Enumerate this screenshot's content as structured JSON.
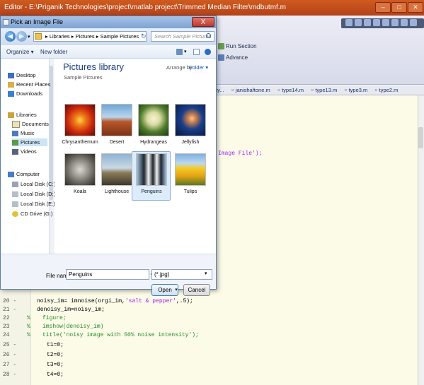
{
  "editor": {
    "title": "Editor - E:\\Priganik Technologies\\project\\matlab project\\Trimmed Median Filter\\mdbutmf.m",
    "toolbar": {
      "run_section": "Run Section",
      "advance": "Advance"
    },
    "tabs": [
      "ty...",
      "janishaftone.m",
      "type14.m",
      "type13.m",
      "type3.m",
      "type2.m"
    ],
    "visible_fragment": "Image File');",
    "lines": [
      {
        "num": "20 -",
        "code": "noisy_im= imnoise(orgi_im,",
        "str": "'salt & pepper'",
        "rest": ",.5);"
      },
      {
        "num": "21 -",
        "code": "denoisy_im=noisy_im;",
        "str": "",
        "rest": ""
      },
      {
        "num": "22",
        "pct": "%",
        "comment": "figure;"
      },
      {
        "num": "23",
        "pct": "%",
        "comment": "imshow(denoisy_im)"
      },
      {
        "num": "24",
        "pct": "%",
        "comment": "title('noisy image with 50% noise intensity');"
      },
      {
        "num": "25 -",
        "code": "t1=0;",
        "str": "",
        "rest": ""
      },
      {
        "num": "26 -",
        "code": "t2=0;",
        "str": "",
        "rest": ""
      },
      {
        "num": "27 -",
        "code": "t3=0;",
        "str": "",
        "rest": ""
      },
      {
        "num": "28 -",
        "code": "t4=0;",
        "str": "",
        "rest": ""
      }
    ]
  },
  "dialog": {
    "title": "Pick an Image File",
    "close_label": "X",
    "address": "▸ Libraries ▸ Pictures ▸ Sample Pictures",
    "search_placeholder": "Search Sample Pictures",
    "organize": "Organize ▾",
    "new_folder": "New folder",
    "nav_items": [
      "Desktop",
      "Recent Places",
      "Downloads",
      "Libraries",
      "Documents",
      "Music",
      "Pictures",
      "Videos",
      "Computer",
      "Local Disk (C:)",
      "Local Disk (D:)",
      "Local Disk (E:)",
      "CD Drive (G:)"
    ],
    "library_title": "Pictures library",
    "library_subtitle": "Sample Pictures",
    "arrange_label": "Arrange by:",
    "arrange_value": "Folder ▾",
    "pictures": [
      "Chrysanthemum",
      "Desert",
      "Hydrangeas",
      "Jellyfish",
      "Koala",
      "Lighthouse",
      "Penguins",
      "Tulips"
    ],
    "file_name_label": "File name:",
    "file_name_value": "Penguins",
    "file_type": "(*.jpg)",
    "open_label": "Open",
    "cancel_label": "Cancel"
  },
  "colors": {
    "title_orange": "#c04a1c",
    "dialog_title": "#8fb1dc",
    "code_background": "#fbfbe8",
    "comment_green": "#228b22",
    "string_purple": "#a020f0"
  }
}
